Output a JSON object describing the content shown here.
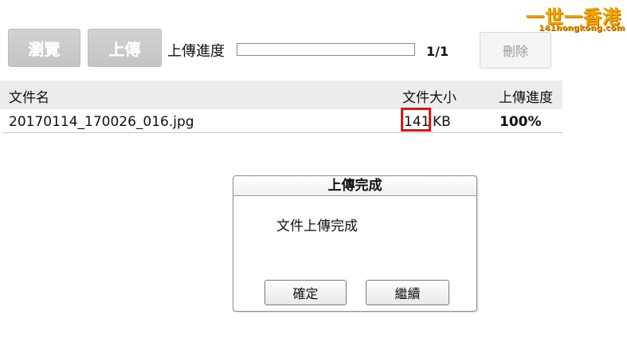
{
  "toolbar": {
    "browse_label": "瀏覽",
    "upload_label": "上傳",
    "progress_label": "上傳進度",
    "progress_count": "1/1",
    "progress_fraction": 1.0,
    "delete_label": "刪除"
  },
  "table": {
    "headers": [
      "文件名",
      "文件大小",
      "上傳進度"
    ],
    "rows": [
      {
        "filename": "20170114_170026_016.jpg",
        "size_value": "141",
        "size_unit": "KB",
        "progress": "100%"
      }
    ]
  },
  "dialog": {
    "title": "上傳完成",
    "message": "文件上傳完成",
    "confirm_label": "確定",
    "continue_label": "繼續"
  },
  "watermark": {
    "text": "一世一香港",
    "subtext": "141hongkong.com"
  },
  "colors": {
    "highlight": "#e01515",
    "logo": "#f2a400"
  }
}
